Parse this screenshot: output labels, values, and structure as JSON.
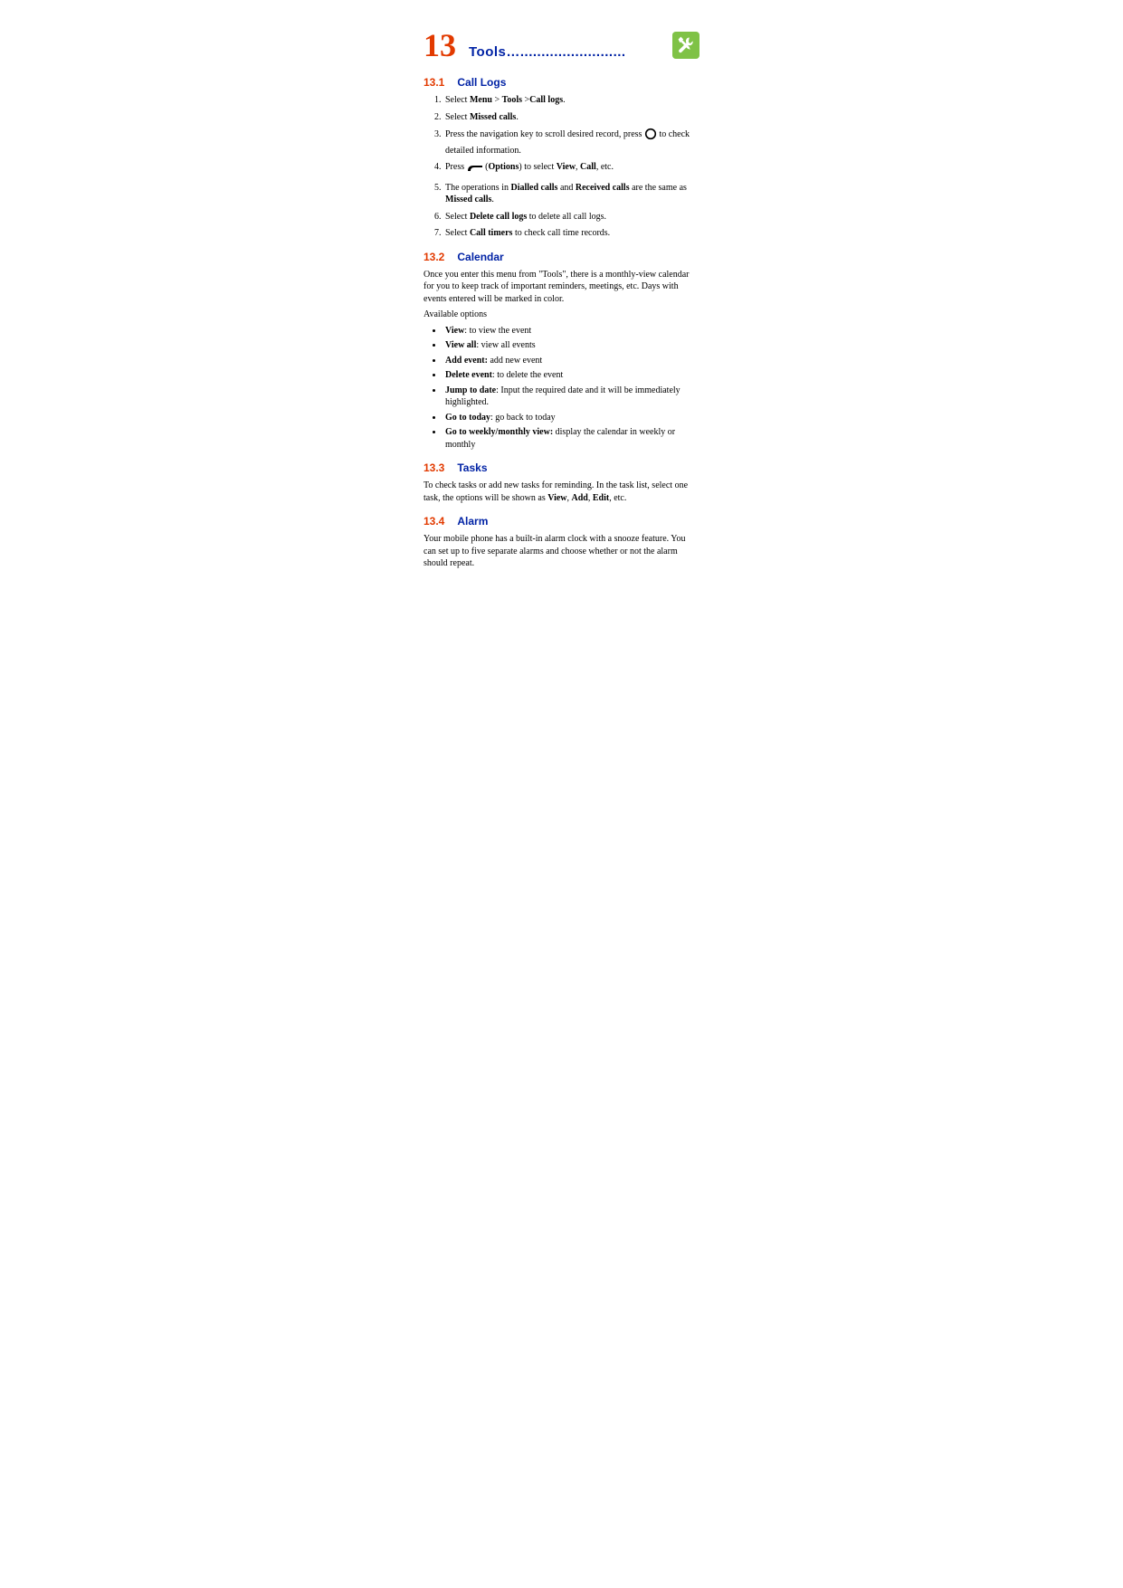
{
  "chapter": {
    "num": "13",
    "title": "Tools…........................."
  },
  "s131": {
    "num": "13.1",
    "title": "Call Logs",
    "i1a": "Select ",
    "i1b": "Menu",
    "i1c": " > ",
    "i1d": "Tools",
    "i1e": " >",
    "i1f": "Call logs",
    "i1g": ".",
    "i2a": "Select ",
    "i2b": "Missed calls",
    "i2c": ".",
    "i3a": "Press the navigation key to scroll desired record, press ",
    "i3b": " to check detailed information.",
    "i4a": "Press ",
    "i4b": " (",
    "i4c": "Options",
    "i4d": ") to select ",
    "i4e": "View",
    "i4f": ", ",
    "i4g": "Call",
    "i4h": ", etc.",
    "i5a": "The operations in ",
    "i5b": "Dialled calls",
    "i5c": " and ",
    "i5d": "Received calls",
    "i5e": " are the same as ",
    "i5f": "Missed calls",
    "i5g": ".",
    "i6a": "Select ",
    "i6b": "Delete call logs",
    "i6c": " to delete all call logs.",
    "i7a": "Select ",
    "i7b": "Call timers",
    "i7c": " to check call time records."
  },
  "s132": {
    "num": "13.2",
    "title": "Calendar",
    "p1": "Once you enter this menu from \"Tools\", there is a monthly-view calendar for you to keep track of important reminders, meetings, etc. Days with events entered will be marked in color.",
    "p2": "Available options",
    "b1a": "View",
    "b1b": ": to view the event",
    "b2a": "View all",
    "b2b": ": view all events",
    "b3a": "Add event:",
    "b3b": " add new event",
    "b4a": "Delete event",
    "b4b": ": to delete the event",
    "b5a": "Jump to date",
    "b5b": ": Input the required date and it will be immediately highlighted.",
    "b6a": "Go to today",
    "b6b": ": go back to today",
    "b7a": "Go to weekly/monthly view:",
    "b7b": " display the calendar in weekly or monthly"
  },
  "s133": {
    "num": "13.3",
    "title": "Tasks",
    "p1a": "To check tasks or add new tasks for reminding. In the task list, select one task, the options will be shown as ",
    "p1b": "View",
    "p1c": ", ",
    "p1d": "Add",
    "p1e": ", ",
    "p1f": "Edit",
    "p1g": ", etc."
  },
  "s134": {
    "num": "13.4",
    "title": "Alarm",
    "p1": "Your mobile phone has a built-in alarm clock with a snooze feature. You can set up to five separate alarms and choose whether or not the alarm should repeat."
  }
}
